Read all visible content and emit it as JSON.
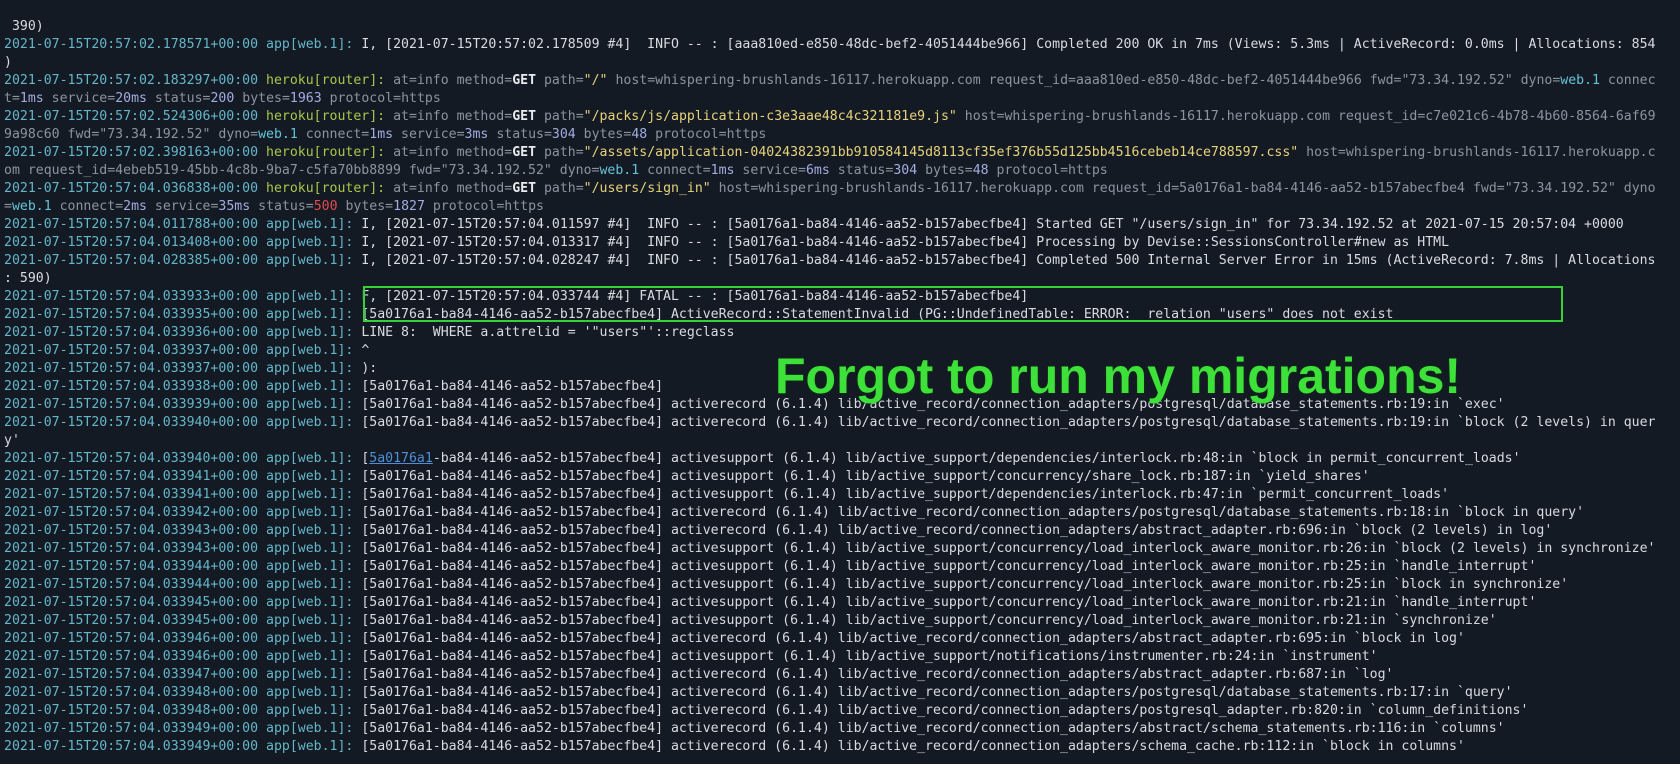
{
  "annotation": {
    "text": "Forgot to run my migrations!",
    "box_color": "#36d13a",
    "text_color": "#3ee03a"
  },
  "colors": {
    "background": "#141a24",
    "timestamp": "#64b6c9",
    "heroku_source": "#a9c64a",
    "status_error": "#e14b4b"
  },
  "log_lines": [
    {
      "cont": true,
      "msg": " 390)"
    },
    {
      "ts": "2021-07-15T20:57:02.178571+00:00",
      "src": "app[web.1]:",
      "kind": "app",
      "msg": "I, [2021-07-15T20:57:02.178509 #4]  INFO -- : [aaa810ed-e850-48dc-bef2-4051444be966] Completed 200 OK in 7ms (Views: 5.3ms | ActiveRecord: 0.0ms | Allocations: 854"
    },
    {
      "cont": true,
      "msg": ")"
    },
    {
      "ts": "2021-07-15T20:57:02.183297+00:00",
      "src": "heroku[router]:",
      "kind": "router",
      "parts": [
        {
          "k": "at=",
          "v": "info"
        },
        {
          "k": " method=",
          "v": "GET",
          "t": "method"
        },
        {
          "k": " path=",
          "v": "\"/\"",
          "t": "path"
        },
        {
          "k": " host=",
          "v": "whispering-brushlands-16117.herokuapp.com"
        },
        {
          "k": " request_id=",
          "v": "aaa810ed-e850-48dc-bef2-4051444be966"
        },
        {
          "k": " fwd=",
          "v": "\"73.34.192.52\""
        },
        {
          "k": " dyno=",
          "v": "web.1",
          "t": "dyno"
        },
        {
          "k": " connec",
          "v": ""
        }
      ]
    },
    {
      "cont": true,
      "kind": "router",
      "parts": [
        {
          "k": "t=",
          "v": "1ms",
          "t": "num"
        },
        {
          "k": " service=",
          "v": "20ms",
          "t": "num"
        },
        {
          "k": " status=",
          "v": "200",
          "t": "num"
        },
        {
          "k": " bytes=",
          "v": "1963",
          "t": "num"
        },
        {
          "k": " protocol=",
          "v": "https"
        }
      ]
    },
    {
      "ts": "2021-07-15T20:57:02.524306+00:00",
      "src": "heroku[router]:",
      "kind": "router",
      "parts": [
        {
          "k": "at=",
          "v": "info"
        },
        {
          "k": " method=",
          "v": "GET",
          "t": "method"
        },
        {
          "k": " path=",
          "v": "\"/packs/js/application-c3e3aae48c4c321181e9.js\"",
          "t": "path"
        },
        {
          "k": " host=",
          "v": "whispering-brushlands-16117.herokuapp.com"
        },
        {
          "k": " request_id=",
          "v": "c7e021c6-4b78-4b60-8564-6af69"
        }
      ]
    },
    {
      "cont": true,
      "kind": "router",
      "parts": [
        {
          "k": "",
          "v": "9a98c60"
        },
        {
          "k": " fwd=",
          "v": "\"73.34.192.52\""
        },
        {
          "k": " dyno=",
          "v": "web.1",
          "t": "dyno"
        },
        {
          "k": " connect=",
          "v": "1ms",
          "t": "num"
        },
        {
          "k": " service=",
          "v": "3ms",
          "t": "num"
        },
        {
          "k": " status=",
          "v": "304",
          "t": "num"
        },
        {
          "k": " bytes=",
          "v": "48",
          "t": "num"
        },
        {
          "k": " protocol=",
          "v": "https"
        }
      ]
    },
    {
      "ts": "2021-07-15T20:57:02.398163+00:00",
      "src": "heroku[router]:",
      "kind": "router",
      "parts": [
        {
          "k": "at=",
          "v": "info"
        },
        {
          "k": " method=",
          "v": "GET",
          "t": "method"
        },
        {
          "k": " path=",
          "v": "\"/assets/application-04024382391bb910584145d8113cf35ef376b55d125bb4516cebeb14ce788597.css\"",
          "t": "path"
        },
        {
          "k": " host=",
          "v": "whispering-brushlands-16117.herokuapp.c"
        }
      ]
    },
    {
      "cont": true,
      "kind": "router",
      "parts": [
        {
          "k": "om request_id=",
          "v": "4ebeb519-45bb-4c8b-9ba7-c5fa70bb8899"
        },
        {
          "k": " fwd=",
          "v": "\"73.34.192.52\""
        },
        {
          "k": " dyno=",
          "v": "web.1",
          "t": "dyno"
        },
        {
          "k": " connect=",
          "v": "1ms",
          "t": "num"
        },
        {
          "k": " service=",
          "v": "6ms",
          "t": "num"
        },
        {
          "k": " status=",
          "v": "304",
          "t": "num"
        },
        {
          "k": " bytes=",
          "v": "48",
          "t": "num"
        },
        {
          "k": " protocol=",
          "v": "https"
        }
      ]
    },
    {
      "ts": "2021-07-15T20:57:04.036838+00:00",
      "src": "heroku[router]:",
      "kind": "router",
      "parts": [
        {
          "k": "at=",
          "v": "info"
        },
        {
          "k": " method=",
          "v": "GET",
          "t": "method"
        },
        {
          "k": " path=",
          "v": "\"/users/sign_in\"",
          "t": "path"
        },
        {
          "k": " host=",
          "v": "whispering-brushlands-16117.herokuapp.com"
        },
        {
          "k": " request_id=",
          "v": "5a0176a1-ba84-4146-aa52-b157abecfbe4"
        },
        {
          "k": " fwd=",
          "v": "\"73.34.192.52\""
        },
        {
          "k": " dyno",
          "v": ""
        }
      ]
    },
    {
      "cont": true,
      "kind": "router",
      "parts": [
        {
          "k": "=",
          "v": "web.1",
          "t": "dyno"
        },
        {
          "k": " connect=",
          "v": "2ms",
          "t": "num"
        },
        {
          "k": " service=",
          "v": "35ms",
          "t": "num"
        },
        {
          "k": " status=",
          "v": "500",
          "t": "bad"
        },
        {
          "k": " bytes=",
          "v": "1827",
          "t": "num"
        },
        {
          "k": " protocol=",
          "v": "https"
        }
      ]
    },
    {
      "ts": "2021-07-15T20:57:04.011788+00:00",
      "src": "app[web.1]:",
      "kind": "app",
      "msg": "I, [2021-07-15T20:57:04.011597 #4]  INFO -- : [5a0176a1-ba84-4146-aa52-b157abecfbe4] Started GET \"/users/sign_in\" for 73.34.192.52 at 2021-07-15 20:57:04 +0000"
    },
    {
      "ts": "2021-07-15T20:57:04.013408+00:00",
      "src": "app[web.1]:",
      "kind": "app",
      "msg": "I, [2021-07-15T20:57:04.013317 #4]  INFO -- : [5a0176a1-ba84-4146-aa52-b157abecfbe4] Processing by Devise::SessionsController#new as HTML"
    },
    {
      "ts": "2021-07-15T20:57:04.028385+00:00",
      "src": "app[web.1]:",
      "kind": "app",
      "msg": "I, [2021-07-15T20:57:04.028247 #4]  INFO -- : [5a0176a1-ba84-4146-aa52-b157abecfbe4] Completed 500 Internal Server Error in 15ms (ActiveRecord: 7.8ms | Allocations"
    },
    {
      "cont": true,
      "msg": ": 590)"
    },
    {
      "ts": "2021-07-15T20:57:04.033933+00:00",
      "src": "app[web.1]:",
      "kind": "app",
      "msg": "F, [2021-07-15T20:57:04.033744 #4] FATAL -- : [5a0176a1-ba84-4146-aa52-b157abecfbe4]"
    },
    {
      "ts": "2021-07-15T20:57:04.033935+00:00",
      "src": "app[web.1]:",
      "kind": "app",
      "msg": "[5a0176a1-ba84-4146-aa52-b157abecfbe4] ActiveRecord::StatementInvalid (PG::UndefinedTable: ERROR:  relation \"users\" does not exist"
    },
    {
      "ts": "2021-07-15T20:57:04.033936+00:00",
      "src": "app[web.1]:",
      "kind": "app",
      "msg": "LINE 8:  WHERE a.attrelid = '\"users\"'::regclass"
    },
    {
      "ts": "2021-07-15T20:57:04.033937+00:00",
      "src": "app[web.1]:",
      "kind": "app",
      "msg": "^"
    },
    {
      "ts": "2021-07-15T20:57:04.033937+00:00",
      "src": "app[web.1]:",
      "kind": "app",
      "msg": "):"
    },
    {
      "ts": "2021-07-15T20:57:04.033938+00:00",
      "src": "app[web.1]:",
      "kind": "app",
      "msg": "[5a0176a1-ba84-4146-aa52-b157abecfbe4]"
    },
    {
      "ts": "2021-07-15T20:57:04.033939+00:00",
      "src": "app[web.1]:",
      "kind": "app",
      "msg": "[5a0176a1-ba84-4146-aa52-b157abecfbe4] activerecord (6.1.4) lib/active_record/connection_adapters/postgresql/database_statements.rb:19:in `exec'"
    },
    {
      "ts": "2021-07-15T20:57:04.033940+00:00",
      "src": "app[web.1]:",
      "kind": "app",
      "msg": "[5a0176a1-ba84-4146-aa52-b157abecfbe4] activerecord (6.1.4) lib/active_record/connection_adapters/postgresql/database_statements.rb:19:in `block (2 levels) in quer"
    },
    {
      "cont": true,
      "msg": "y'"
    },
    {
      "ts": "2021-07-15T20:57:04.033940+00:00",
      "src": "app[web.1]:",
      "kind": "app",
      "link": "5a0176a1",
      "msg": "-ba84-4146-aa52-b157abecfbe4] activesupport (6.1.4) lib/active_support/dependencies/interlock.rb:48:in `block in permit_concurrent_loads'"
    },
    {
      "ts": "2021-07-15T20:57:04.033941+00:00",
      "src": "app[web.1]:",
      "kind": "app",
      "msg": "[5a0176a1-ba84-4146-aa52-b157abecfbe4] activesupport (6.1.4) lib/active_support/concurrency/share_lock.rb:187:in `yield_shares'"
    },
    {
      "ts": "2021-07-15T20:57:04.033941+00:00",
      "src": "app[web.1]:",
      "kind": "app",
      "msg": "[5a0176a1-ba84-4146-aa52-b157abecfbe4] activesupport (6.1.4) lib/active_support/dependencies/interlock.rb:47:in `permit_concurrent_loads'"
    },
    {
      "ts": "2021-07-15T20:57:04.033942+00:00",
      "src": "app[web.1]:",
      "kind": "app",
      "msg": "[5a0176a1-ba84-4146-aa52-b157abecfbe4] activerecord (6.1.4) lib/active_record/connection_adapters/postgresql/database_statements.rb:18:in `block in query'"
    },
    {
      "ts": "2021-07-15T20:57:04.033943+00:00",
      "src": "app[web.1]:",
      "kind": "app",
      "msg": "[5a0176a1-ba84-4146-aa52-b157abecfbe4] activerecord (6.1.4) lib/active_record/connection_adapters/abstract_adapter.rb:696:in `block (2 levels) in log'"
    },
    {
      "ts": "2021-07-15T20:57:04.033943+00:00",
      "src": "app[web.1]:",
      "kind": "app",
      "msg": "[5a0176a1-ba84-4146-aa52-b157abecfbe4] activesupport (6.1.4) lib/active_support/concurrency/load_interlock_aware_monitor.rb:26:in `block (2 levels) in synchronize'"
    },
    {
      "ts": "2021-07-15T20:57:04.033944+00:00",
      "src": "app[web.1]:",
      "kind": "app",
      "msg": "[5a0176a1-ba84-4146-aa52-b157abecfbe4] activesupport (6.1.4) lib/active_support/concurrency/load_interlock_aware_monitor.rb:25:in `handle_interrupt'"
    },
    {
      "ts": "2021-07-15T20:57:04.033944+00:00",
      "src": "app[web.1]:",
      "kind": "app",
      "msg": "[5a0176a1-ba84-4146-aa52-b157abecfbe4] activesupport (6.1.4) lib/active_support/concurrency/load_interlock_aware_monitor.rb:25:in `block in synchronize'"
    },
    {
      "ts": "2021-07-15T20:57:04.033945+00:00",
      "src": "app[web.1]:",
      "kind": "app",
      "msg": "[5a0176a1-ba84-4146-aa52-b157abecfbe4] activesupport (6.1.4) lib/active_support/concurrency/load_interlock_aware_monitor.rb:21:in `handle_interrupt'"
    },
    {
      "ts": "2021-07-15T20:57:04.033945+00:00",
      "src": "app[web.1]:",
      "kind": "app",
      "msg": "[5a0176a1-ba84-4146-aa52-b157abecfbe4] activesupport (6.1.4) lib/active_support/concurrency/load_interlock_aware_monitor.rb:21:in `synchronize'"
    },
    {
      "ts": "2021-07-15T20:57:04.033946+00:00",
      "src": "app[web.1]:",
      "kind": "app",
      "msg": "[5a0176a1-ba84-4146-aa52-b157abecfbe4] activerecord (6.1.4) lib/active_record/connection_adapters/abstract_adapter.rb:695:in `block in log'"
    },
    {
      "ts": "2021-07-15T20:57:04.033946+00:00",
      "src": "app[web.1]:",
      "kind": "app",
      "msg": "[5a0176a1-ba84-4146-aa52-b157abecfbe4] activesupport (6.1.4) lib/active_support/notifications/instrumenter.rb:24:in `instrument'"
    },
    {
      "ts": "2021-07-15T20:57:04.033947+00:00",
      "src": "app[web.1]:",
      "kind": "app",
      "msg": "[5a0176a1-ba84-4146-aa52-b157abecfbe4] activerecord (6.1.4) lib/active_record/connection_adapters/abstract_adapter.rb:687:in `log'"
    },
    {
      "ts": "2021-07-15T20:57:04.033948+00:00",
      "src": "app[web.1]:",
      "kind": "app",
      "msg": "[5a0176a1-ba84-4146-aa52-b157abecfbe4] activerecord (6.1.4) lib/active_record/connection_adapters/postgresql/database_statements.rb:17:in `query'"
    },
    {
      "ts": "2021-07-15T20:57:04.033948+00:00",
      "src": "app[web.1]:",
      "kind": "app",
      "msg": "[5a0176a1-ba84-4146-aa52-b157abecfbe4] activerecord (6.1.4) lib/active_record/connection_adapters/postgresql_adapter.rb:820:in `column_definitions'"
    },
    {
      "ts": "2021-07-15T20:57:04.033949+00:00",
      "src": "app[web.1]:",
      "kind": "app",
      "msg": "[5a0176a1-ba84-4146-aa52-b157abecfbe4] activerecord (6.1.4) lib/active_record/connection_adapters/abstract/schema_statements.rb:116:in `columns'"
    },
    {
      "ts": "2021-07-15T20:57:04.033949+00:00",
      "src": "app[web.1]:",
      "kind": "app",
      "msg": "[5a0176a1-ba84-4146-aa52-b157abecfbe4] activerecord (6.1.4) lib/active_record/connection_adapters/schema_cache.rb:112:in `block in columns'"
    }
  ]
}
